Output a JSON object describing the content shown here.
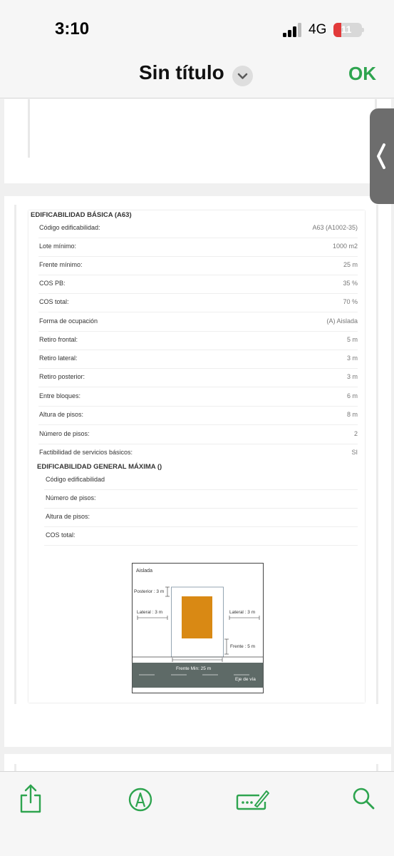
{
  "status_bar": {
    "time": "3:10",
    "network": "4G",
    "battery": "11"
  },
  "nav": {
    "title": "Sin título",
    "ok_label": "OK"
  },
  "section_basic": {
    "title": "EDIFICABILIDAD BÁSICA (A63)",
    "rows": [
      {
        "label": "Código edificabilidad:",
        "value": "A63 (A1002-35)"
      },
      {
        "label": "Lote mínimo:",
        "value": "1000 m2"
      },
      {
        "label": "Frente mínimo:",
        "value": "25 m"
      },
      {
        "label": "COS PB:",
        "value": "35 %"
      },
      {
        "label": "COS total:",
        "value": "70 %"
      },
      {
        "label": "Forma de ocupación",
        "value": "(A) Aislada"
      },
      {
        "label": "Retiro frontal:",
        "value": "5 m"
      },
      {
        "label": "Retiro lateral:",
        "value": "3 m"
      },
      {
        "label": "Retiro posterior:",
        "value": "3 m"
      },
      {
        "label": "Entre bloques:",
        "value": "6 m"
      },
      {
        "label": "Altura de pisos:",
        "value": "8 m"
      },
      {
        "label": "Número de pisos:",
        "value": "2"
      },
      {
        "label": "Factibilidad de servicios básicos:",
        "value": "SI"
      }
    ]
  },
  "section_max": {
    "title": "EDIFICABILIDAD GENERAL MÁXIMA ()",
    "rows": [
      {
        "label": "Código edificabilidad"
      },
      {
        "label": "Número de pisos:"
      },
      {
        "label": "Altura de pisos:"
      },
      {
        "label": "COS total:"
      }
    ]
  },
  "diagram": {
    "type_label": "Aislada",
    "posterior_label": "Posterior : 3 m",
    "lateral_left_label": "Lateral : 3 m",
    "lateral_right_label": "Lateral : 3 m",
    "frente_label": "Frente : 5 m",
    "frente_min_label": "Frente Min: 25 m",
    "eje_label": "Eje de vía",
    "building_color": "#d98914",
    "road_color": "#5e6a67"
  },
  "toolbar": {
    "share_icon": "share-icon",
    "markup_icon": "markup-pen-icon",
    "signature_icon": "signature-icon",
    "search_icon": "search-icon",
    "accent_color": "#2ea44f"
  }
}
